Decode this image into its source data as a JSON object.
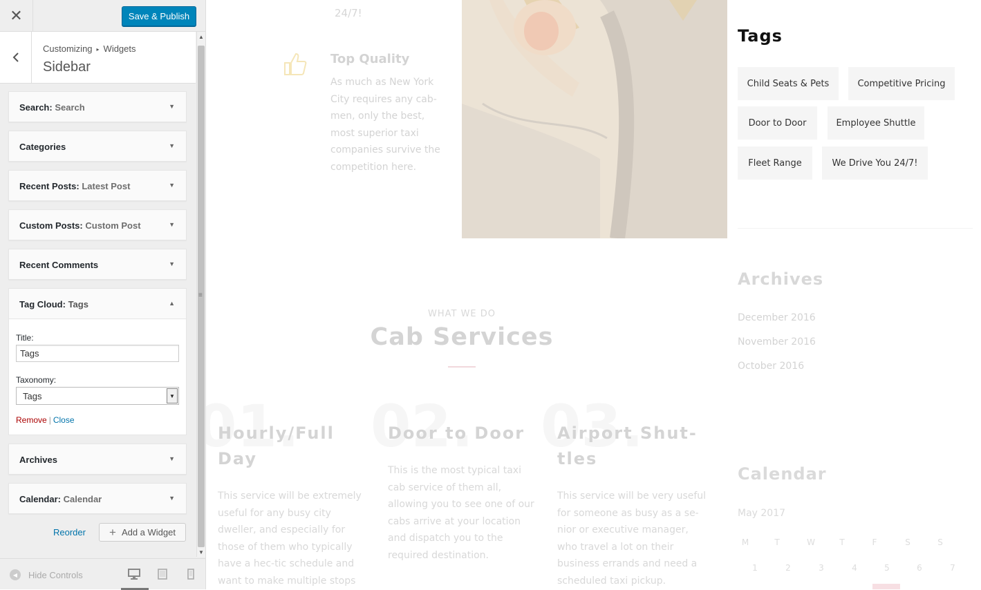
{
  "header": {
    "close_icon": "close-icon",
    "save_label": "Save & Publish",
    "accent": "#0085ba"
  },
  "section": {
    "breadcrumb_root": "Customizing",
    "breadcrumb_child": "Widgets",
    "title": "Sidebar"
  },
  "widgets": [
    {
      "name": "Search",
      "sub": "Search"
    },
    {
      "name": "Categories",
      "sub": ""
    },
    {
      "name": "Recent Posts",
      "sub": "Latest Post"
    },
    {
      "name": "Custom Posts",
      "sub": "Custom Post"
    },
    {
      "name": "Recent Comments",
      "sub": ""
    },
    {
      "name": "Tag Cloud",
      "sub": "Tags"
    },
    {
      "name": "Archives",
      "sub": ""
    },
    {
      "name": "Calendar",
      "sub": "Calendar"
    }
  ],
  "tag_cloud_form": {
    "title_label": "Title:",
    "title_value": "Tags",
    "taxonomy_label": "Taxonomy:",
    "taxonomy_value": "Tags",
    "remove_label": "Remove",
    "pipe": "|",
    "close_label": "Close"
  },
  "footer_actions": {
    "reorder_label": "Reorder",
    "add_widget_label": "Add a Widget"
  },
  "bottom_bar": {
    "hide_controls_label": "Hide Controls"
  },
  "preview": {
    "top_service_text": "24/7!",
    "top_quality": {
      "title": "Top Quality",
      "text": "As much as New York City requires any cab-men, only the best, most superior taxi companies survive the competition here."
    },
    "tags_widget": {
      "title": "Tags",
      "tags": [
        "Child Seats & Pets",
        "Competitive Pricing",
        "Door to Door",
        "Employee Shuttle",
        "Fleet Range",
        "We Drive You 24/7!"
      ]
    },
    "archives_widget": {
      "title": "Archives",
      "items": [
        "December 2016",
        "November 2016",
        "October 2016"
      ]
    },
    "services": {
      "kicker": "WHAT WE DO",
      "heading": "Cab Services",
      "items": [
        {
          "num": "01.",
          "title_line1": "Hourly/Full",
          "title_line2": "Day",
          "text": "This service will be extremely useful for any busy city dweller, and especially for those of them who typically have a hec-tic schedule and want to make multiple stops en route."
        },
        {
          "num": "02.",
          "title_line1": "Door to Door",
          "title_line2": "",
          "text": "This is the most typical taxi cab service of them all, allowing you to see one of our cabs arrive at your location and dispatch you to the required destination."
        },
        {
          "num": "03.",
          "title_line1": "Airport Shut-",
          "title_line2": "tles",
          "text": "This service will be very useful for someone as busy as a se-nior or executive manager, who travel a lot on their business errands and need a scheduled taxi pickup."
        }
      ]
    },
    "calendar_widget": {
      "title": "Calendar",
      "month": "May 2017",
      "weekdays": [
        "M",
        "T",
        "W",
        "T",
        "F",
        "S",
        "S"
      ],
      "first_row": [
        "1",
        "2",
        "3",
        "4",
        "5",
        "6",
        "7"
      ]
    }
  }
}
